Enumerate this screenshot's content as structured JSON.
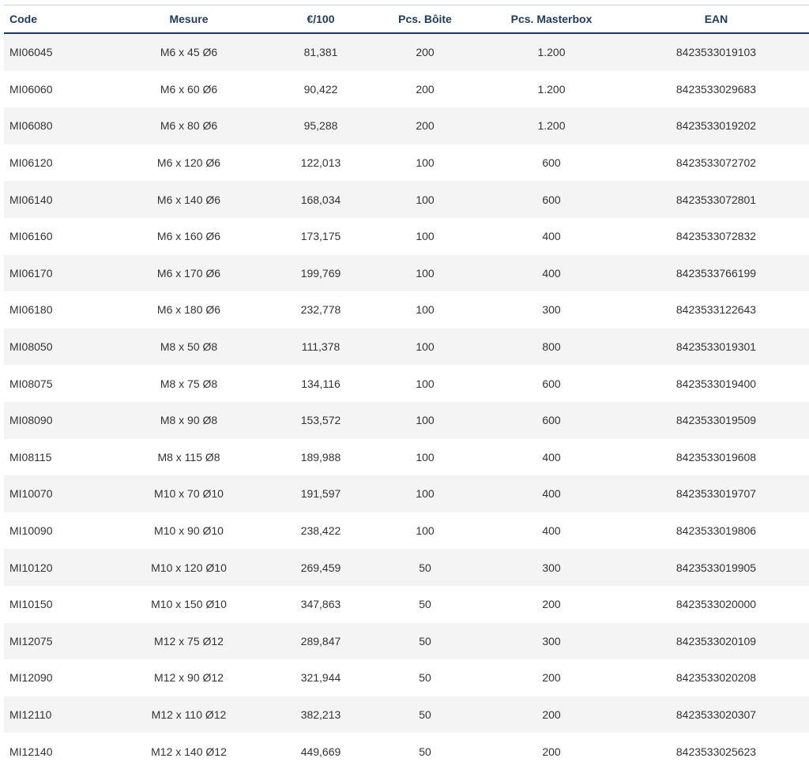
{
  "table": {
    "headers": [
      "Code",
      "Mesure",
      "€/100",
      "Pcs. Bôite",
      "Pcs. Masterbox",
      "EAN"
    ],
    "rows": [
      [
        "MI06045",
        "M6 x 45 Ø6",
        "81,381",
        "200",
        "1.200",
        "8423533019103"
      ],
      [
        "MI06060",
        "M6 x 60 Ø6",
        "90,422",
        "200",
        "1.200",
        "8423533029683"
      ],
      [
        "MI06080",
        "M6 x 80 Ø6",
        "95,288",
        "200",
        "1.200",
        "8423533019202"
      ],
      [
        "MI06120",
        "M6 x 120 Ø6",
        "122,013",
        "100",
        "600",
        "8423533072702"
      ],
      [
        "MI06140",
        "M6 x 140 Ø6",
        "168,034",
        "100",
        "600",
        "8423533072801"
      ],
      [
        "MI06160",
        "M6 x 160 Ø6",
        "173,175",
        "100",
        "400",
        "8423533072832"
      ],
      [
        "MI06170",
        "M6 x 170 Ø6",
        "199,769",
        "100",
        "400",
        "8423533766199"
      ],
      [
        "MI06180",
        "M6 x 180 Ø6",
        "232,778",
        "100",
        "300",
        "8423533122643"
      ],
      [
        "MI08050",
        "M8 x 50 Ø8",
        "111,378",
        "100",
        "800",
        "8423533019301"
      ],
      [
        "MI08075",
        "M8 x 75 Ø8",
        "134,116",
        "100",
        "600",
        "8423533019400"
      ],
      [
        "MI08090",
        "M8 x 90 Ø8",
        "153,572",
        "100",
        "600",
        "8423533019509"
      ],
      [
        "MI08115",
        "M8 x 115 Ø8",
        "189,988",
        "100",
        "400",
        "8423533019608"
      ],
      [
        "MI10070",
        "M10 x 70 Ø10",
        "191,597",
        "100",
        "400",
        "8423533019707"
      ],
      [
        "MI10090",
        "M10 x 90 Ø10",
        "238,422",
        "100",
        "400",
        "8423533019806"
      ],
      [
        "MI10120",
        "M10 x 120 Ø10",
        "269,459",
        "50",
        "300",
        "8423533019905"
      ],
      [
        "MI10150",
        "M10 x 150 Ø10",
        "347,863",
        "50",
        "200",
        "8423533020000"
      ],
      [
        "MI12075",
        "M12 x 75 Ø12",
        "289,847",
        "50",
        "300",
        "8423533020109"
      ],
      [
        "MI12090",
        "M12 x 90 Ø12",
        "321,944",
        "50",
        "200",
        "8423533020208"
      ],
      [
        "MI12110",
        "M12 x 110 Ø12",
        "382,213",
        "50",
        "200",
        "8423533020307"
      ],
      [
        "MI12140",
        "M12 x 140 Ø12",
        "449,669",
        "50",
        "200",
        "8423533025623"
      ]
    ]
  },
  "colors": {
    "header_text": "#1f3a5c",
    "header_rule": "#1f3a5c",
    "row_stripe": "#f4f4f4",
    "cell_text": "#333333"
  }
}
